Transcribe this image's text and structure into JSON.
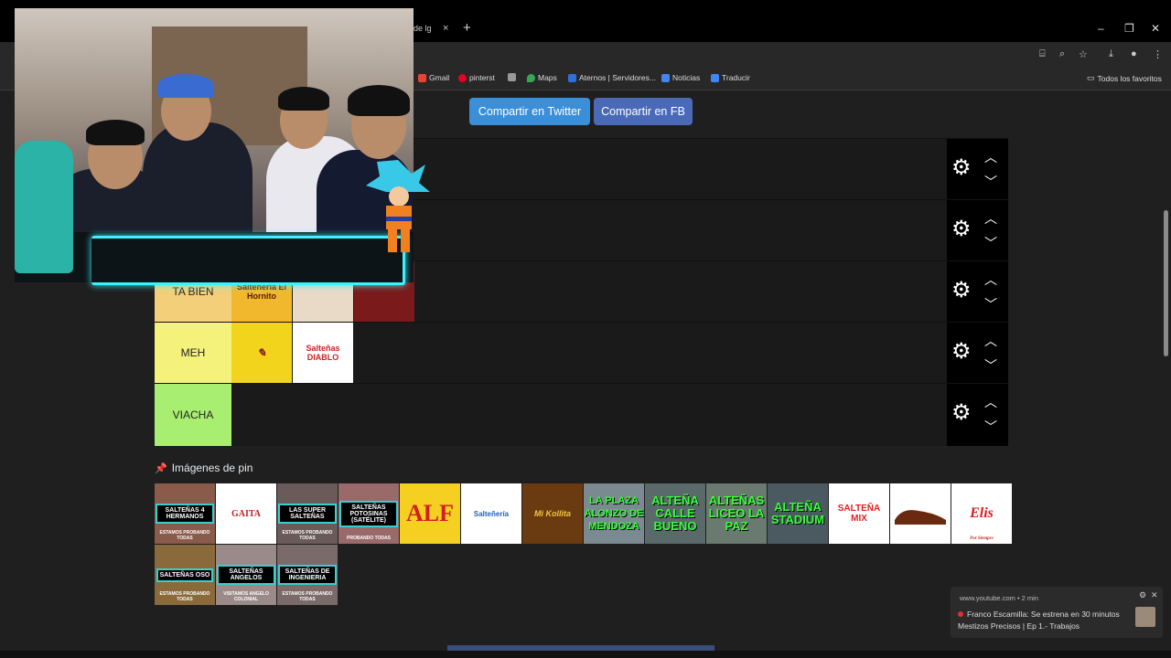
{
  "browser": {
    "tab_fragment": "de lg",
    "tab_close": "×",
    "new_tab": "+",
    "window_controls": [
      "–",
      "❐",
      "✕"
    ],
    "bookmarks": [
      {
        "label": "Gmail",
        "icon": "gmail-icon",
        "color": "#ea4335"
      },
      {
        "label": "pinterst",
        "icon": "pinterest-icon",
        "color": "#e60023"
      },
      {
        "label": "",
        "icon": "misc-icon",
        "color": "#999999"
      },
      {
        "label": "Maps",
        "icon": "maps-icon",
        "color": "#34a853"
      },
      {
        "label": "Aternos | Servidores...",
        "icon": "aternos-icon",
        "color": "#2f6fd8"
      },
      {
        "label": "Noticias",
        "icon": "news-icon",
        "color": "#4285f4"
      },
      {
        "label": "Traducir",
        "icon": "translate-icon",
        "color": "#4285f4"
      }
    ],
    "all_bookmarks": "Todos los favoritos"
  },
  "share": {
    "twitter": "Compartir en Twitter",
    "facebook": "Compartir en FB"
  },
  "tiers": [
    {
      "label": "",
      "color": "#1a1a1a",
      "items": []
    },
    {
      "label": "",
      "color": "#1a1a1a",
      "items": []
    },
    {
      "label": "TA BIEN",
      "color": "#f3cf7a",
      "items": [
        {
          "text": "Salteñería El Hornito",
          "bg": "#f1b82d",
          "fg": "#5a1a0a"
        },
        {
          "text": "",
          "bg": "#e9d9c7",
          "fg": "#333"
        },
        {
          "text": "",
          "bg": "#7a1a1a",
          "fg": "#f5c542"
        }
      ]
    },
    {
      "label": "MEH",
      "color": "#f5f27c",
      "items": [
        {
          "text": "",
          "bg": "#f2d41c",
          "fg": "#222"
        },
        {
          "text": "Salteñas DIABLO",
          "bg": "#ffffff",
          "fg": "#d02020"
        }
      ]
    },
    {
      "label": "VIACHA",
      "color": "#a8ef71",
      "items": []
    }
  ],
  "controls": {
    "gear": "⚙",
    "up": "︿",
    "down": "︿"
  },
  "pin": {
    "title": "Imágenes de pin",
    "icon": "📌",
    "images": [
      {
        "label": "SALTEÑAS 4 HERMANOS",
        "sub": "ESTAMOS PROBANDO TODAS",
        "bg": "#8a5a4a",
        "style": "box"
      },
      {
        "label": "GAITA",
        "sub": "",
        "bg": "#ffffff",
        "style": "logo"
      },
      {
        "label": "LAS SUPER SALTEÑAS",
        "sub": "ESTAMOS PROBANDO TODAS",
        "bg": "#6a5a5a",
        "style": "box"
      },
      {
        "label": "SALTEÑAS POTOSINAS (SATÉLITE)",
        "sub": "PROBANDO TODAS",
        "bg": "#9a6a6a",
        "style": "box"
      },
      {
        "label": "ALF",
        "sub": "",
        "bg": "#f5d020",
        "style": "alf"
      },
      {
        "label": "Salteñería",
        "sub": "",
        "bg": "#ffffff",
        "style": "logo-blue"
      },
      {
        "label": "Mi Kollita",
        "sub": "",
        "bg": "#6a3a10",
        "style": "kollita"
      },
      {
        "label": "LA PLAZA ALONZO DE MENDOZA",
        "sub": "",
        "bg": "#7a8a90",
        "style": "green"
      },
      {
        "label": "ALTEÑA CALLE BUENO",
        "sub": "",
        "bg": "#5a6a6a",
        "style": "green"
      },
      {
        "label": "ALTEÑAS LICEO LA PAZ",
        "sub": "",
        "bg": "#6a7a70",
        "style": "green"
      },
      {
        "label": "ALTEÑA STADIUM",
        "sub": "",
        "bg": "#4a5a60",
        "style": "green"
      },
      {
        "label": "SALTEÑA MIX",
        "sub": "",
        "bg": "#ffffff",
        "style": "mix"
      },
      {
        "label": "",
        "sub": "",
        "bg": "#ffffff",
        "style": "shoe"
      },
      {
        "label": "Elis",
        "sub": "Por Siempre",
        "bg": "#ffffff",
        "style": "elis"
      },
      {
        "label": "SALTEÑAS OSO",
        "sub": "ESTAMOS PROBANDO TODAS",
        "bg": "#8a6a3a",
        "style": "box"
      },
      {
        "label": "SALTEÑAS ANGELOS",
        "sub": "VISITAMOS ANGELO COLONIAL",
        "bg": "#9a8a8a",
        "style": "box"
      },
      {
        "label": "SALTEÑAS DE INGENIERIA",
        "sub": "ESTAMOS PROBANDO TODAS",
        "bg": "#7a6a6a",
        "style": "box"
      }
    ]
  },
  "notification": {
    "source": "www.youtube.com",
    "time": "2 min",
    "line1": "Franco Escamilla: Se estrena en 30 minutos",
    "line2": "Mestizos Precisos | Ep 1.- Trabajos"
  },
  "colors": {
    "neon": "#3ff0ff",
    "accent_twitter": "#3a8fd8",
    "accent_fb": "#4a6ab8"
  }
}
